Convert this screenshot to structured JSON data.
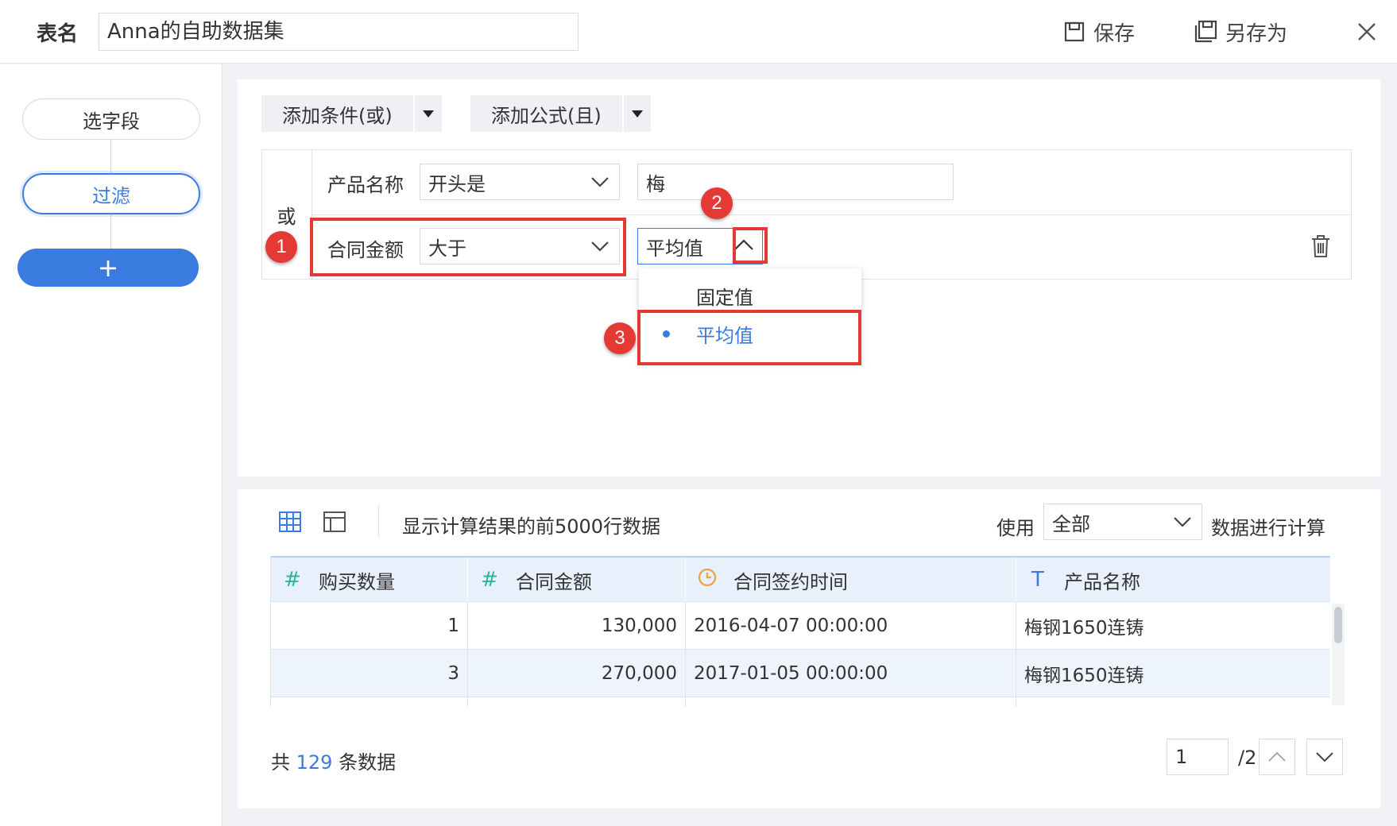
{
  "header": {
    "table_name_label": "表名",
    "table_name_value": "Anna的自助数据集",
    "save_label": "保存",
    "save_as_label": "另存为"
  },
  "sidebar": {
    "steps": [
      "选字段",
      "过滤"
    ],
    "add_label": "+"
  },
  "filter": {
    "add_condition_label": "添加条件(或)",
    "add_formula_label": "添加公式(且)",
    "or_label": "或",
    "conditions": [
      {
        "field": "产品名称",
        "operator": "开头是",
        "value": "梅"
      },
      {
        "field": "合同金额",
        "operator": "大于",
        "value": "平均值"
      }
    ],
    "value_type_options": [
      "固定值",
      "平均值"
    ],
    "selected_value_type": "平均值"
  },
  "annotations": [
    "1",
    "2",
    "3"
  ],
  "data_view": {
    "info_text": "显示计算结果的前5000行数据",
    "use_label": "使用",
    "use_select": "全部",
    "use_after": "数据进行计算",
    "columns": [
      {
        "icon": "#",
        "name": "购买数量"
      },
      {
        "icon": "#",
        "name": "合同金额"
      },
      {
        "icon": "clock",
        "name": "合同签约时间"
      },
      {
        "icon": "T",
        "name": "产品名称"
      }
    ],
    "rows": [
      [
        "1",
        "130,000",
        "2016-04-07 00:00:00",
        "梅钢1650连铸"
      ],
      [
        "3",
        "270,000",
        "2017-01-05 00:00:00",
        "梅钢1650连铸"
      ]
    ],
    "total_prefix": "共",
    "total_count": "129",
    "total_suffix": "条数据",
    "current_page": "1",
    "page_total": "/2"
  },
  "colors": {
    "accent": "#3a7be0",
    "highlight": "#e53935",
    "number_icon": "#2bb39b",
    "date_icon": "#f0a040"
  }
}
